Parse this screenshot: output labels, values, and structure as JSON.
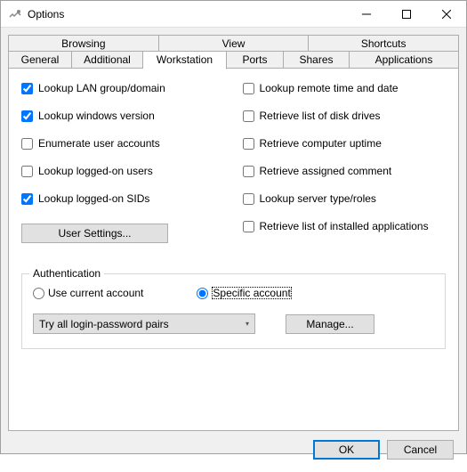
{
  "window": {
    "title": "Options"
  },
  "tabs_top": {
    "t0": "Browsing",
    "t1": "View",
    "t2": "Shortcuts"
  },
  "tabs_bottom": {
    "t0": "General",
    "t1": "Additional",
    "t2": "Workstation",
    "t3": "Ports",
    "t4": "Shares",
    "t5": "Applications"
  },
  "left": {
    "c0": "Lookup LAN group/domain",
    "c1": "Lookup windows version",
    "c2": "Enumerate user accounts",
    "c3": "Lookup logged-on users",
    "c4": "Lookup logged-on SIDs",
    "btn": "User Settings..."
  },
  "right": {
    "c0": "Lookup remote time and date",
    "c1": "Retrieve list of disk drives",
    "c2": "Retrieve computer uptime",
    "c3": "Retrieve assigned comment",
    "c4": "Lookup server type/roles",
    "c5": "Retrieve list of installed applications"
  },
  "auth": {
    "legend": "Authentication",
    "r0": "Use current account",
    "r1": "Specific account",
    "combo": "Try all login-password pairs",
    "manage": "Manage..."
  },
  "footer": {
    "ok": "OK",
    "cancel": "Cancel"
  }
}
